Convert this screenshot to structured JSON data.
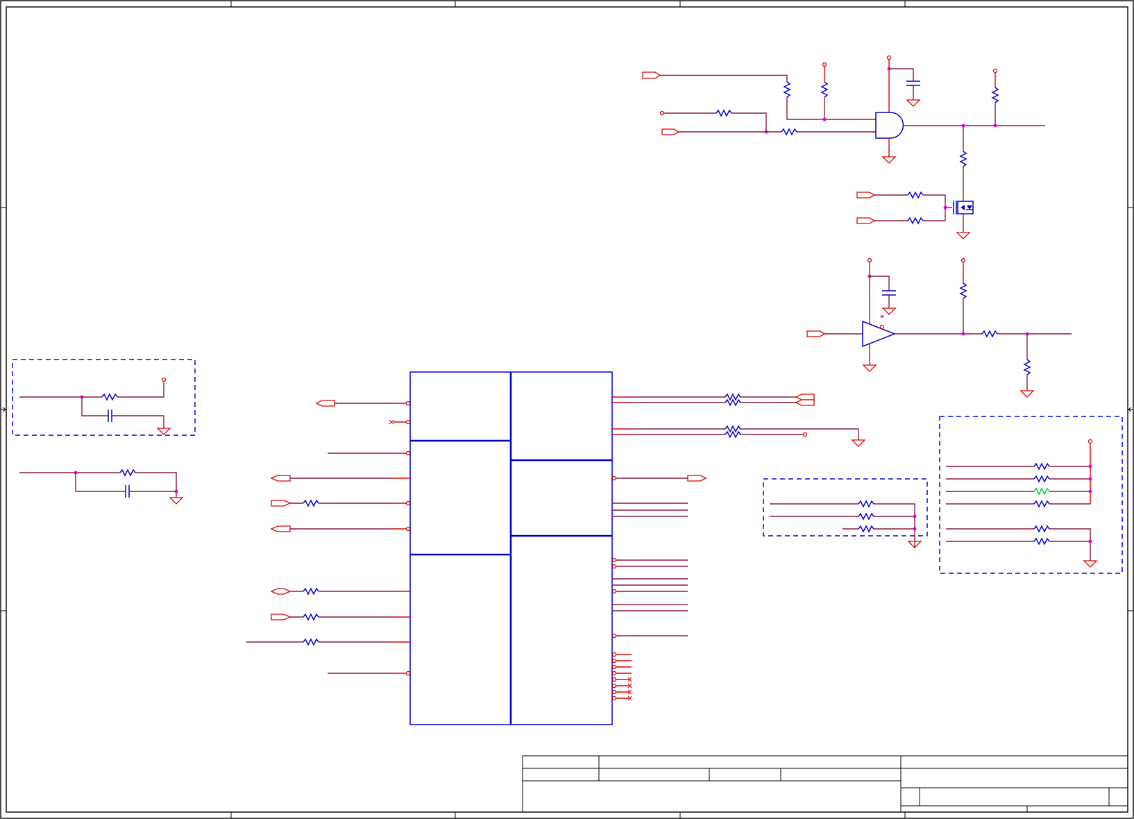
{
  "sheet": {
    "zone_columns": 5,
    "zone_rows": 4
  },
  "colors": {
    "wire": "#8b1a3c",
    "pin": "#e00000",
    "component": "#0000cc",
    "junction": "#e000e0",
    "group_box": "#0000ee",
    "highlight_resistor": "#00cc33",
    "frame": "#000000"
  },
  "title_block": {
    "title": "",
    "size": "",
    "document_number": "",
    "revision": "",
    "date": "",
    "sheet": ""
  }
}
